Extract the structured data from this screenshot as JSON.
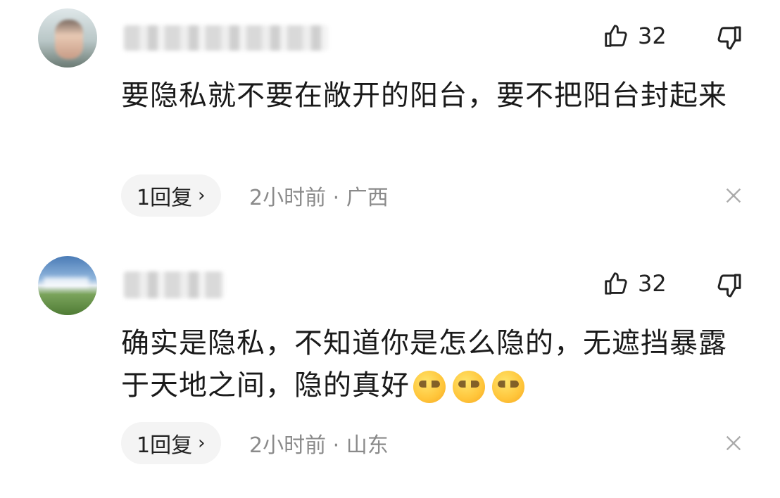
{
  "comments": [
    {
      "username": "",
      "likes": "32",
      "text": "要隐私就不要在敞开的阳台，要不把阳台封起来",
      "reply_label": "1回复",
      "reply_chevron": "›",
      "time": "2小时前",
      "dot": "·",
      "location": "广西",
      "emojis": []
    },
    {
      "username": "",
      "likes": "32",
      "text": "确实是隐私，不知道你是怎么隐的，无遮挡暴露于天地之间，隐的真好",
      "reply_label": "1回复",
      "reply_chevron": "›",
      "time": "2小时前",
      "dot": "·",
      "location": "山东",
      "emojis": [
        "smirk-emoji",
        "smirk-emoji",
        "smirk-emoji"
      ]
    }
  ],
  "icons": {
    "like": "thumb-up-icon",
    "dislike": "thumb-down-icon",
    "close": "close-icon"
  },
  "colors": {
    "meta_text": "#8a8a8a",
    "pill_bg": "#f4f4f4",
    "body_text": "#1a1a1a"
  }
}
